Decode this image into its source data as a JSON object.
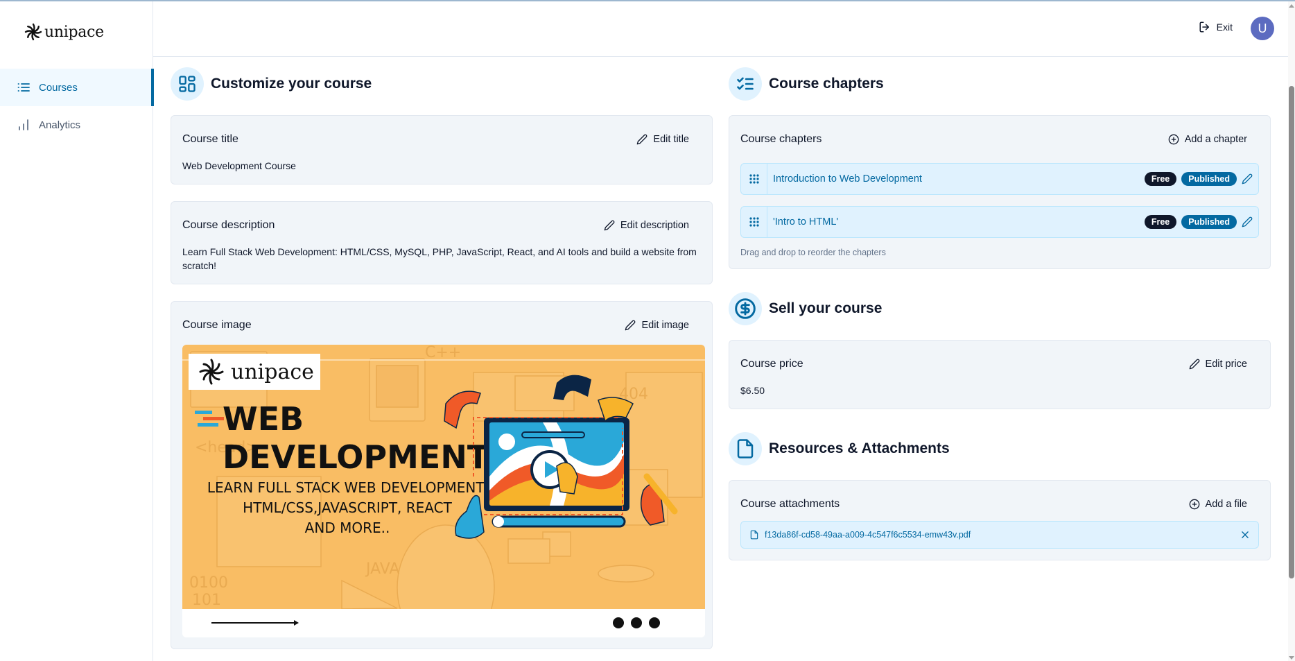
{
  "brand": {
    "name": "unipace"
  },
  "sidebar": {
    "items": [
      {
        "label": "Courses",
        "icon": "list-icon",
        "active": true
      },
      {
        "label": "Analytics",
        "icon": "bar-chart-icon",
        "active": false
      }
    ]
  },
  "header": {
    "exit_label": "Exit",
    "avatar_initial": "U",
    "avatar_color": "#5c6bc0"
  },
  "customize": {
    "section_title": "Customize your course",
    "title_card": {
      "label": "Course title",
      "action": "Edit title",
      "value": "Web Development Course"
    },
    "description_card": {
      "label": "Course description",
      "action": "Edit description",
      "value": "Learn Full Stack Web Development: HTML/CSS, MySQL, PHP, JavaScript, React, and AI tools and build a website from scratch!"
    },
    "image_card": {
      "label": "Course image",
      "action": "Edit image",
      "image_text": {
        "brand": "unipace",
        "headline_1": "WEB",
        "headline_2": "DEVELOPMENT",
        "sub_1": "LEARN FULL STACK WEB DEVELOPMENT:",
        "sub_2": "HTML/CSS,JAVASCRIPT, REACT",
        "sub_3": "AND MORE..",
        "bg_labels": [
          "C++",
          "404",
          "JAVA",
          "0100",
          "101",
          "<head>"
        ]
      }
    }
  },
  "chapters": {
    "section_title": "Course chapters",
    "card_label": "Course chapters",
    "action": "Add a chapter",
    "items": [
      {
        "title": "Introduction to Web Development",
        "badges": [
          "Free",
          "Published"
        ]
      },
      {
        "title": "'Intro to HTML'",
        "badges": [
          "Free",
          "Published"
        ]
      }
    ],
    "hint": "Drag and drop to reorder the chapters"
  },
  "sell": {
    "section_title": "Sell your course",
    "card_label": "Course price",
    "action": "Edit price",
    "value": "$6.50"
  },
  "resources": {
    "section_title": "Resources & Attachments",
    "card_label": "Course attachments",
    "action": "Add a file",
    "files": [
      {
        "name": "f13da86f-cd58-49aa-a009-4c547f6c5534-emw43v.pdf"
      }
    ]
  },
  "colors": {
    "accent": "#0369a1",
    "accent_light": "#e0f2fe",
    "card_bg": "#f1f5f9",
    "badge_dark": "#0f172a",
    "image_bg": "#f9bd64"
  }
}
